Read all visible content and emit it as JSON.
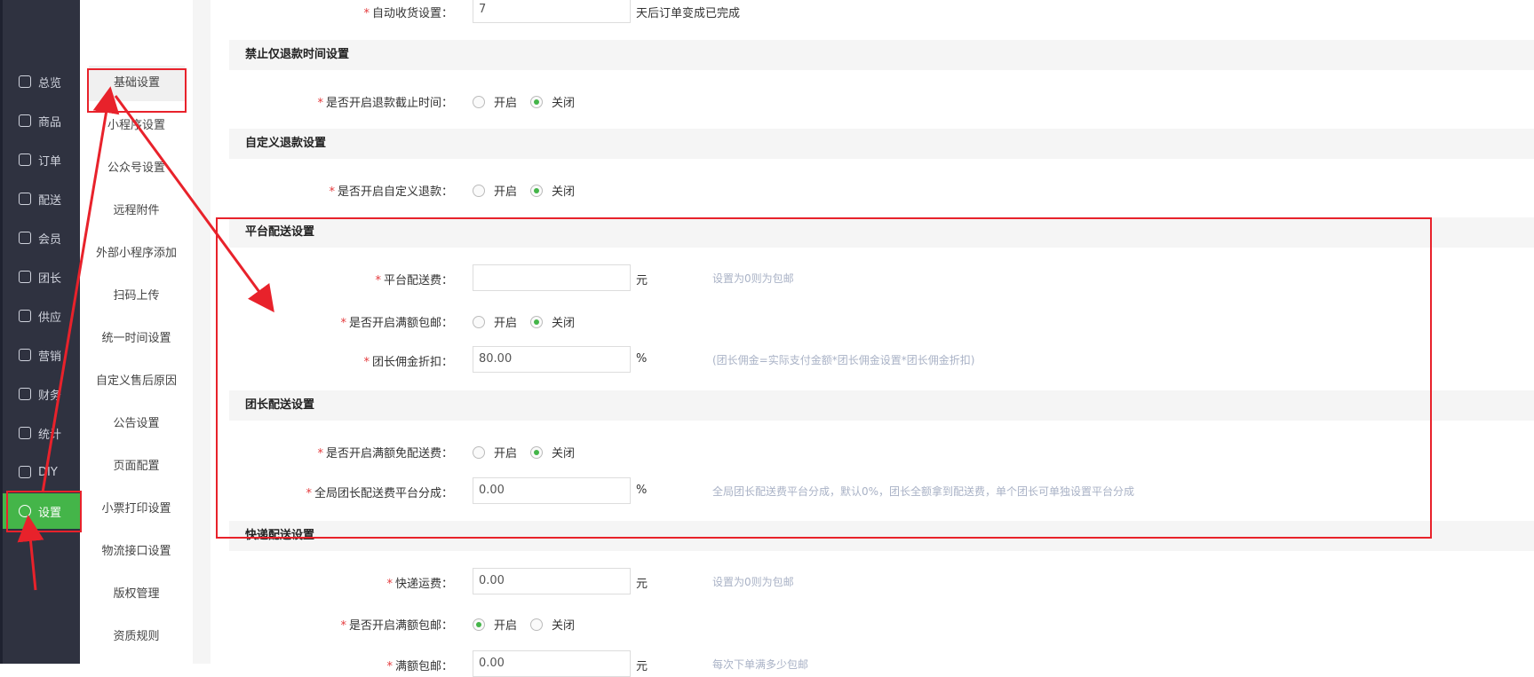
{
  "nav": [
    {
      "label": "总览",
      "icon": "home-icon"
    },
    {
      "label": "商品",
      "icon": "goods-icon"
    },
    {
      "label": "订单",
      "icon": "order-icon"
    },
    {
      "label": "配送",
      "icon": "delivery-icon"
    },
    {
      "label": "会员",
      "icon": "member-icon"
    },
    {
      "label": "团长",
      "icon": "leader-icon"
    },
    {
      "label": "供应",
      "icon": "supply-icon"
    },
    {
      "label": "营销",
      "icon": "gift-icon"
    },
    {
      "label": "财务",
      "icon": "finance-icon"
    },
    {
      "label": "统计",
      "icon": "chart-icon"
    },
    {
      "label": "DIY",
      "icon": "diy-icon"
    },
    {
      "label": "设置",
      "icon": "gear-icon"
    }
  ],
  "subnav": [
    "基础设置",
    "小程序设置",
    "公众号设置",
    "远程附件",
    "外部小程序添加",
    "扫码上传",
    "统一时间设置",
    "自定义售后原因",
    "公告设置",
    "页面配置",
    "小票打印设置",
    "物流接口设置",
    "版权管理",
    "资质规则"
  ],
  "top": {
    "label": "自动收货设置：",
    "value": "7",
    "after": "天后订单变成已完成"
  },
  "sections": {
    "refund_time": {
      "title": "禁止仅退款时间设置",
      "label": "是否开启退款截止时间："
    },
    "custom_refund": {
      "title": "自定义退款设置",
      "label": "是否开启自定义退款："
    },
    "platform": {
      "title": "平台配送设置",
      "fee_label": "平台配送费：",
      "fee_value": "",
      "fee_unit": "元",
      "fee_hint": "设置为0则为包邮",
      "free_label": "是否开启满额包邮：",
      "discount_label": "团长佣金折扣：",
      "discount_value": "80.00",
      "discount_unit": "%",
      "discount_hint": "(团长佣金=实际支付金额*团长佣金设置*团长佣金折扣)"
    },
    "leader": {
      "title": "团长配送设置",
      "free_label": "是否开启满额免配送费：",
      "share_label": "全局团长配送费平台分成：",
      "share_value": "0.00",
      "share_unit": "%",
      "share_hint": "全局团长配送费平台分成，默认0%，团长全额拿到配送费，单个团长可单独设置平台分成"
    },
    "express": {
      "title": "快递配送设置",
      "fee_label": "快递运费：",
      "fee_value": "0.00",
      "fee_unit": "元",
      "fee_hint": "设置为0则为包邮",
      "free_label": "是否开启满额包邮：",
      "full_label": "满额包邮：",
      "full_value": "0.00",
      "full_unit": "元",
      "full_hint": "每次下单满多少包邮"
    }
  },
  "radio": {
    "on": "开启",
    "off": "关闭"
  },
  "colors": {
    "accent": "#44b549",
    "annotation": "#e8222b"
  }
}
